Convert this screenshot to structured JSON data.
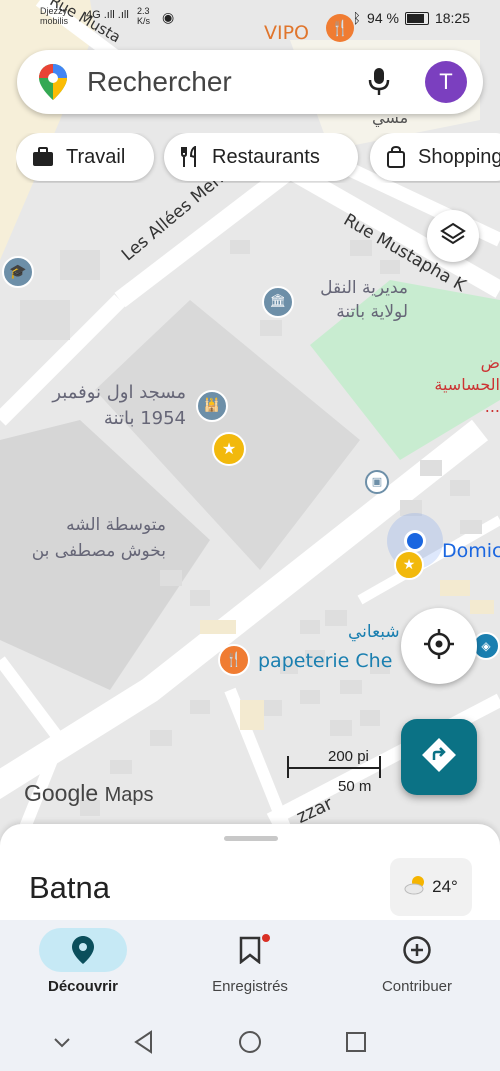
{
  "status_bar": {
    "carrier_line1": "Djezzy",
    "carrier_line2": "mobilis",
    "signal": "4G .ıll .ıll",
    "rate_value": "2.3",
    "rate_unit": "K/s",
    "battery": "94 %",
    "time": "18:25"
  },
  "search": {
    "placeholder": "Rechercher",
    "avatar_letter": "T"
  },
  "chips": [
    {
      "label": "Travail"
    },
    {
      "label": "Restaurants"
    },
    {
      "label": "Shopping"
    }
  ],
  "map_labels": {
    "vipo": "VIPO",
    "street_top_left": "Rue Musta",
    "street_top_right": "Rue Mustapha K",
    "allees": "Les Allées Menas",
    "transport_line1": "مديرية النقل",
    "transport_line2": "لولاية باتنة",
    "mosque_line1": "مسجد اول نوفمبر",
    "mosque_line2": "1954 باتنة",
    "school_line1": "متوسطة الشه",
    "school_line2": "بخوش مصطفى بن",
    "park_line1": "ض",
    "park_line2": "الحساسية ...",
    "top_center_arabic": "مسي",
    "domicile": "Domic",
    "papeterie": "papeterie Che",
    "papeterie_arabic": "شبعاني",
    "street_bottom": "zzar"
  },
  "scale": {
    "imperial": "200 pi",
    "metric": "50 m"
  },
  "google_logo": {
    "word1": "Google",
    "word2": "Maps"
  },
  "sheet": {
    "place": "Batna",
    "temperature": "24°"
  },
  "bottom_nav": [
    {
      "label": "Découvrir",
      "icon": "location-pin-icon",
      "active": true
    },
    {
      "label": "Enregistrés",
      "icon": "bookmark-icon",
      "active": false
    },
    {
      "label": "Contribuer",
      "icon": "add-circle-icon",
      "active": false
    }
  ],
  "colors": {
    "accent": "#0b7285",
    "avatar": "#7b3fbf",
    "park": "#c8ecd0",
    "road": "#ffffff",
    "building": "#dcdcdc",
    "yellow_area": "#f6efd9",
    "restaurant_marker": "#f07c32"
  }
}
